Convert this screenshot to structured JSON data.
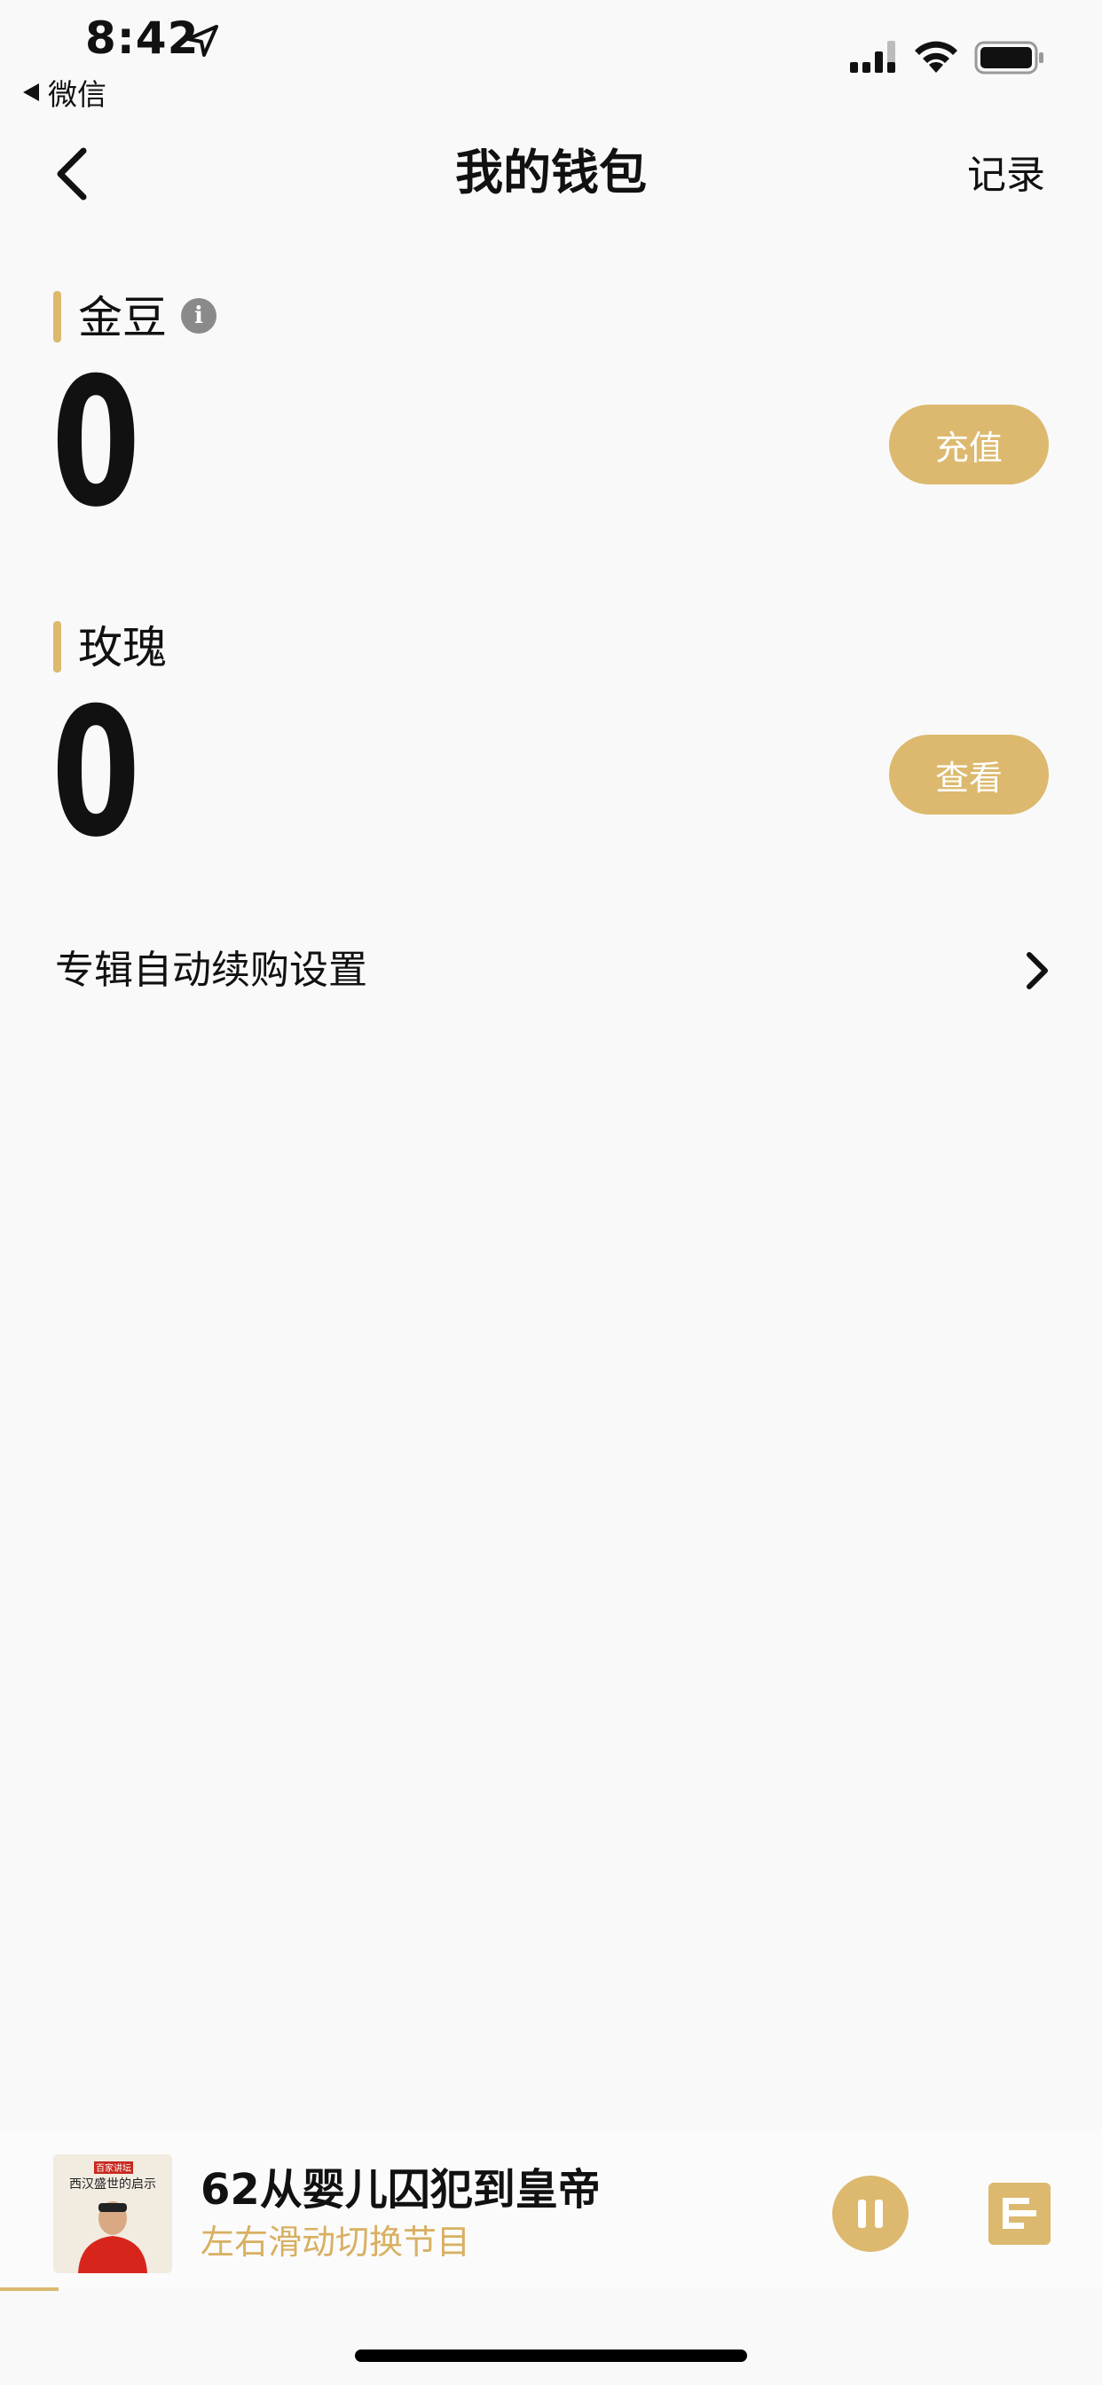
{
  "status_bar": {
    "time": "8:42",
    "back_app": "微信",
    "icons": [
      "location-arrow-icon",
      "signal-icon",
      "wifi-icon",
      "battery-icon"
    ]
  },
  "nav": {
    "title": "我的钱包",
    "right_action": "记录"
  },
  "sections": {
    "gold_beans": {
      "title": "金豆",
      "value": "0",
      "action": "充值",
      "info_icon_glyph": "i"
    },
    "roses": {
      "title": "玫瑰",
      "value": "0",
      "action": "查看"
    }
  },
  "settings": {
    "auto_renew_label": "专辑自动续购设置"
  },
  "player": {
    "track_title": "62从婴儿囚犯到皇帝",
    "subtitle": "左右滑动切换节目",
    "cover_caption": "西汉盛世的启示",
    "cover_badge": "百家讲坛"
  },
  "colors": {
    "accent": "#dcb96e",
    "background": "#f9f9f9",
    "text": "#111111",
    "subtitle": "#d8b062"
  }
}
